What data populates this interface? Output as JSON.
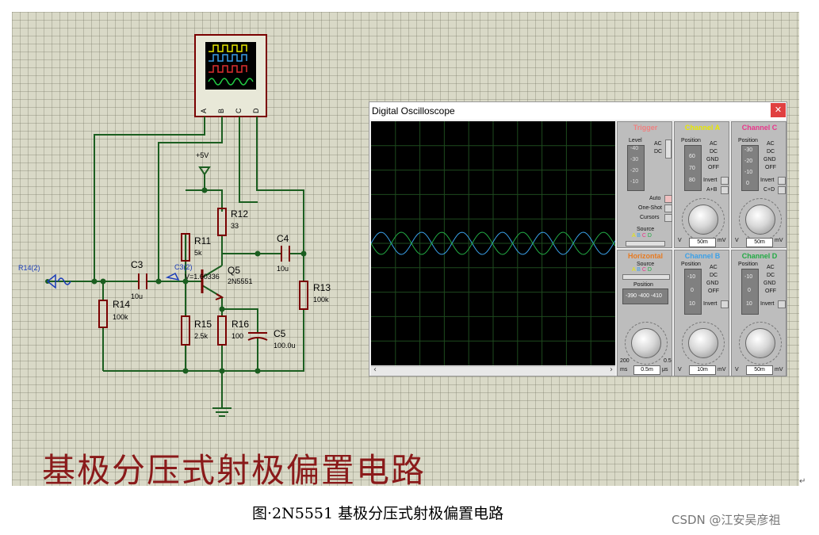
{
  "schematic": {
    "title": "基极分压式射极偏置电路",
    "labels": {
      "r14_2": "R14(2)",
      "c3_2": "C3(2)",
      "c3_2_voltage": "V=1.60336",
      "plus5v": "+5V",
      "c3": "C3",
      "c3_val": "10u",
      "r14": "R14",
      "r14_val": "100k",
      "r11": "R11",
      "r11_val": "5k",
      "r12": "R12",
      "r12_val": "33",
      "q5": "Q5",
      "q5_val": "2N5551",
      "c4": "C4",
      "c4_val": "10u",
      "r13": "R13",
      "r13_val": "100k",
      "r15": "R15",
      "r15_val": "2.5k",
      "r16": "R16",
      "r16_val": "100",
      "c5": "C5",
      "c5_val": "100.0u",
      "scope_a": "A",
      "scope_b": "B",
      "scope_c": "C",
      "scope_d": "D"
    }
  },
  "oscilloscope": {
    "title": "Digital Oscilloscope",
    "close_icon": "close-icon",
    "trigger": {
      "title": "Trigger",
      "level": "Level",
      "level_ticks": [
        "-40",
        "-30",
        "-20",
        "-10"
      ],
      "ac": "AC",
      "dc": "DC",
      "auto": "Auto",
      "one_shot": "One-Shot",
      "cursors": "Cursors",
      "source": "Source",
      "source_options": [
        "A",
        "B",
        "C",
        "D"
      ]
    },
    "horizontal": {
      "title": "Horizontal",
      "source": "Source",
      "source_options": [
        "A",
        "B",
        "C",
        "D"
      ],
      "position": "Position",
      "position_readout": "-390 -400 -410",
      "value": "0.5m",
      "unit_left": "ms",
      "unit_right": "μs",
      "dial_left": "200",
      "dial_right": "0.5"
    },
    "channel_a": {
      "title": "Channel A",
      "position": "Position",
      "ticks": [
        "60",
        "70",
        "80"
      ],
      "value": "50m",
      "unit_left": "V",
      "unit_right": "mV",
      "modes": [
        "AC",
        "DC",
        "GND",
        "OFF",
        "Invert",
        "A+B"
      ]
    },
    "channel_b": {
      "title": "Channel B",
      "position": "Position",
      "ticks": [
        "-10",
        "0",
        "10"
      ],
      "value": "10m",
      "unit_left": "V",
      "unit_right": "mV",
      "modes": [
        "AC",
        "DC",
        "GND",
        "OFF",
        "Invert"
      ]
    },
    "channel_c": {
      "title": "Channel C",
      "position": "Position",
      "ticks": [
        "-30",
        "-20",
        "-10",
        "0"
      ],
      "value": "50m",
      "unit_left": "V",
      "unit_right": "mV",
      "modes": [
        "AC",
        "DC",
        "GND",
        "OFF",
        "Invert",
        "C+D"
      ]
    },
    "channel_d": {
      "title": "Channel D",
      "position": "Position",
      "ticks": [
        "-10",
        "0",
        "10"
      ],
      "value": "50m",
      "unit_left": "V",
      "unit_right": "mV",
      "modes": [
        "AC",
        "DC",
        "GND",
        "OFF",
        "Invert"
      ]
    },
    "colors": {
      "trigger": "#f08080",
      "channel_a": "#e8e800",
      "channel_b": "#3aa0e8",
      "channel_c": "#e8368a",
      "channel_d": "#22aa44",
      "horizontal": "#e87a20",
      "trace_1": "#3aa0e8",
      "trace_2": "#22aa44"
    }
  },
  "caption": "图·2N5551 基极分压式射极偏置电路",
  "watermark": "CSDN @江安吴彦祖"
}
